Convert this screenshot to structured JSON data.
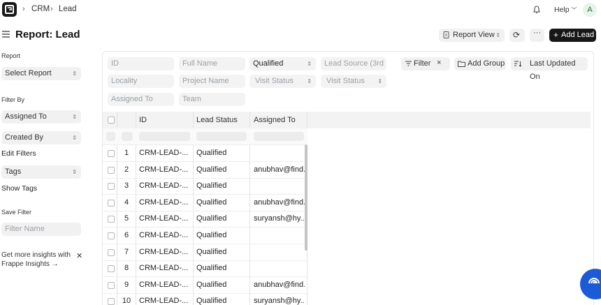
{
  "nav": {
    "breadcrumbs": [
      "CRM",
      "Lead"
    ],
    "help_label": "Help",
    "avatar_letter": "A"
  },
  "header": {
    "title": "Report: Lead",
    "report_view_label": "Report View",
    "add_lead_label": "Add Lead"
  },
  "sidebar": {
    "report_label": "Report",
    "report_select": "Select Report",
    "filter_by_label": "Filter By",
    "assigned_to": "Assigned To",
    "created_by": "Created By",
    "edit_filters": "Edit Filters",
    "tags": "Tags",
    "show_tags": "Show Tags",
    "save_filter_label": "Save Filter",
    "filter_name_placeholder": "Filter Name",
    "insights_line1": "Get more insights with",
    "insights_line2": "Frappe Insights →"
  },
  "filters": {
    "id": "ID",
    "full_name": "Full Name",
    "status_value": "Qualified",
    "lead_source": "Lead Source (3rd",
    "locality": "Locality",
    "project_name": "Project Name",
    "visit_status_1": "Visit Status",
    "visit_status_2": "Visit Status",
    "assigned_to": "Assigned To",
    "team": "Team"
  },
  "toolbar": {
    "filter_label": "Filter",
    "add_group_label": "Add Group",
    "sort_label": "Last Updated On"
  },
  "table": {
    "columns": [
      "ID",
      "Lead Status",
      "Assigned To"
    ],
    "rows": [
      {
        "n": "1",
        "id": "CRM-LEAD-...",
        "status": "Qualified",
        "assigned": ""
      },
      {
        "n": "2",
        "id": "CRM-LEAD-...",
        "status": "Qualified",
        "assigned": "anubhav@find..."
      },
      {
        "n": "3",
        "id": "CRM-LEAD-...",
        "status": "Qualified",
        "assigned": ""
      },
      {
        "n": "4",
        "id": "CRM-LEAD-...",
        "status": "Qualified",
        "assigned": "anubhav@find..."
      },
      {
        "n": "5",
        "id": "CRM-LEAD-...",
        "status": "Qualified",
        "assigned": "suryansh@hy..."
      },
      {
        "n": "6",
        "id": "CRM-LEAD-...",
        "status": "Qualified",
        "assigned": ""
      },
      {
        "n": "7",
        "id": "CRM-LEAD-...",
        "status": "Qualified",
        "assigned": ""
      },
      {
        "n": "8",
        "id": "CRM-LEAD-...",
        "status": "Qualified",
        "assigned": ""
      },
      {
        "n": "9",
        "id": "CRM-LEAD-...",
        "status": "Qualified",
        "assigned": "anubhav@find..."
      },
      {
        "n": "10",
        "id": "CRM-LEAD-...",
        "status": "Qualified",
        "assigned": "suryansh@hy..."
      }
    ]
  },
  "colors": {
    "accent_dark": "#171717",
    "fab_blue": "#1b5bd8"
  }
}
